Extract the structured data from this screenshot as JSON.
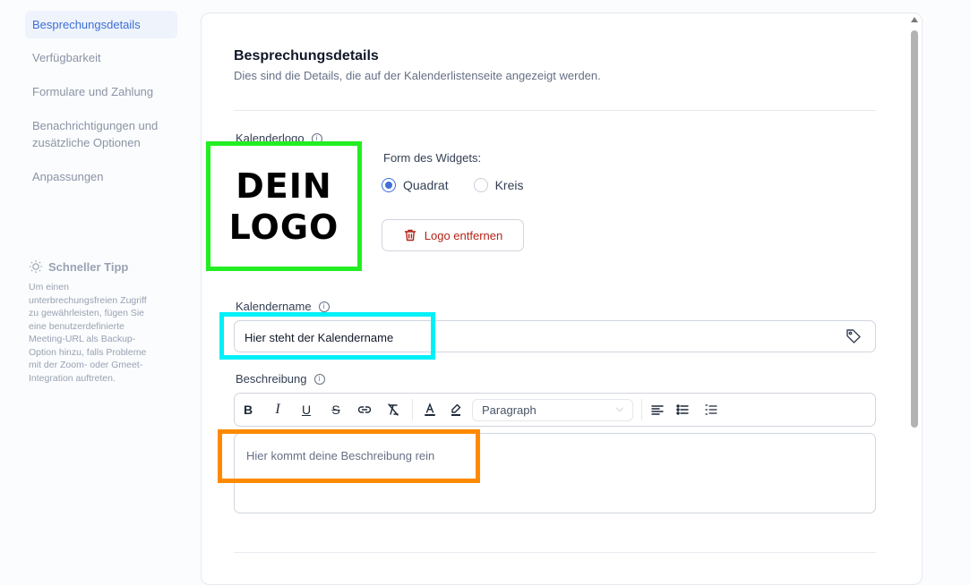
{
  "sidebar": {
    "items": [
      {
        "label": "Besprechungsdetails"
      },
      {
        "label": "Verfügbarkeit"
      },
      {
        "label": "Formulare und Zahlung"
      },
      {
        "label": "Benachrichtigungen und zusätzliche Optionen"
      },
      {
        "label": "Anpassungen"
      }
    ],
    "tip": {
      "title": "Schneller Tipp",
      "text": "Um einen unterbrechungsfreien Zugriff zu gewährleisten, fügen Sie eine benutzerdefinierte Meeting-URL als Backup-Option hinzu, falls Probleme mit der Zoom- oder Gmeet-Integration auftreten."
    }
  },
  "main": {
    "title": "Besprechungsdetails",
    "subtitle": "Dies sind die Details, die auf der Kalenderlistenseite angezeigt werden.",
    "logo": {
      "label": "Kalenderlogo",
      "image_text_line1": "DEIN",
      "image_text_line2": "LOGO",
      "widget_label": "Form des Widgets:",
      "options": [
        {
          "label": "Quadrat",
          "selected": true
        },
        {
          "label": "Kreis",
          "selected": false
        }
      ],
      "remove_label": "Logo entfernen"
    },
    "name": {
      "label": "Kalendername",
      "value": "Hier steht der Kalendername"
    },
    "description": {
      "label": "Beschreibung",
      "format_value": "Paragraph",
      "placeholder": "Hier kommt deine Beschreibung rein"
    }
  },
  "colors": {
    "accent": "#3d6fd6",
    "danger": "#b42318",
    "highlight_green": "#22ee22",
    "highlight_cyan": "#00f0f8",
    "highlight_orange": "#ff8a00"
  },
  "icons": [
    "info-icon",
    "lightbulb-icon",
    "trash-icon",
    "tag-icon",
    "bold-icon",
    "italic-icon",
    "underline-icon",
    "strikethrough-icon",
    "link-icon",
    "clear-format-icon",
    "text-color-icon",
    "highlight-icon",
    "align-left-icon",
    "bullet-list-icon",
    "numbered-list-icon",
    "chevron-down-icon"
  ]
}
